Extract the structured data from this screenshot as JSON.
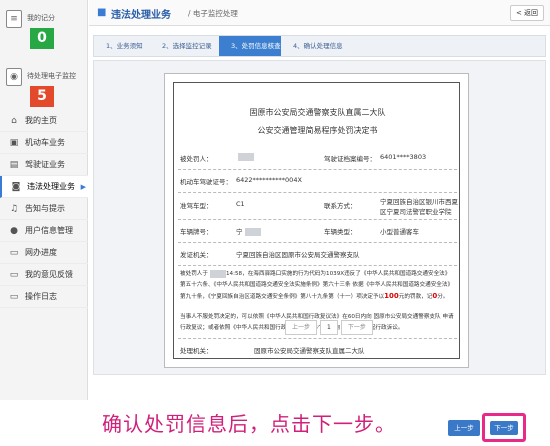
{
  "sidebar": {
    "score1": {
      "label": "我的记分",
      "value": "0",
      "icon": "document-icon"
    },
    "score2": {
      "label": "待处理电子监控",
      "value": "5",
      "icon": "camera-icon"
    },
    "items": [
      {
        "label": "我的主页",
        "icon": "home-icon"
      },
      {
        "label": "机动车业务",
        "icon": "car-icon"
      },
      {
        "label": "驾驶证业务",
        "icon": "license-icon"
      },
      {
        "label": "违法处理业务",
        "icon": "camera-icon"
      },
      {
        "label": "告知与提示",
        "icon": "bell-icon"
      },
      {
        "label": "用户信息管理",
        "icon": "user-icon"
      },
      {
        "label": "网办进度",
        "icon": "progress-icon"
      },
      {
        "label": "我的意见反馈",
        "icon": "feedback-icon"
      },
      {
        "label": "操作日志",
        "icon": "log-icon"
      }
    ]
  },
  "header": {
    "title": "违法处理业务",
    "breadcrumb": "/ 电子监控处理",
    "back_label": "< 返回"
  },
  "steps": [
    "1、业务须知",
    "2、选择监控记录",
    "3、处罚信息核查",
    "4、确认处理信息"
  ],
  "document": {
    "issuer": "固原市公安局交通警察支队直属二大队",
    "title": "公安交通管理简易程序处罚决定书",
    "fields": {
      "punished_label": "被处罚人：",
      "license_no_label": "驾驶证档案编号：",
      "license_no_value": "6401****3803",
      "vehicle_license_label": "机动车驾驶证号：",
      "vehicle_license_value": "6422**********004X",
      "class_label": "准驾车型：",
      "class_value": "C1",
      "contact_label": "联系方式：",
      "contact_value_1": "宁夏回族自治区银川市西夏",
      "contact_value_2": "区宁夏司法警官职业学院",
      "plate_label": "车辆牌号：",
      "plate_value": "宁",
      "vehicle_type_label": "车辆类型：",
      "vehicle_type_value": "小型普通客车",
      "agency_label": "发证机关：",
      "agency_value": "宁夏回族自治区固原市公安局交通警察支队"
    },
    "paragraph1_a": "被处罚人于",
    "paragraph1_time": "14:58",
    "paragraph1_b": "，在海西驿路口实施的行为代码为1039X违反了《中华人民共和国道路交通安全法》第五十六条、《中华人民共和国道路交通安全法实施条例》第六十三条 依据《中华人民共和国道路交通安全法》第九十条，《宁夏回族自治区道路交通安全条例》第八十九条第（十一）项决定予以",
    "fine_amount": "100",
    "paragraph1_c": "元的罚款，记",
    "points": "0",
    "paragraph1_d": "分。",
    "paragraph2": "当事人不服处罚决定的，可以依照《中华人民共和国行政复议法》在60日内向 固原市公安局交通警察支队 申请行政复议；或者依照《中华人民共和国行政诉讼法》在6个月内向 人民法院提起行政诉讼。",
    "handler_label": "处理机关：",
    "handler_value": "固原市公安局交通警察支队直属二大队"
  },
  "pager": {
    "prev": "上一步",
    "current": "1",
    "next": "下一步"
  },
  "caption": "确认处罚信息后，点击下一步。",
  "buttons": {
    "prev": "上一步",
    "next": "下一步"
  },
  "colors": {
    "accent": "#3a78c8",
    "highlight": "#e8298a",
    "caption": "#d0207a",
    "fine": "#dd0000"
  }
}
